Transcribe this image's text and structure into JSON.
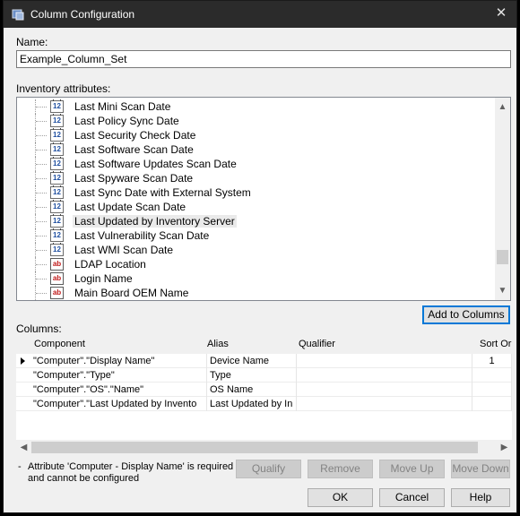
{
  "window": {
    "title": "Column Configuration",
    "close_glyph": "✕"
  },
  "name_label": "Name:",
  "name_value": "Example_Column_Set",
  "inventory_label": "Inventory attributes:",
  "tree_items": [
    {
      "label": "Last Mini Scan Date",
      "icon": "date-attribute-icon",
      "glyph": "12"
    },
    {
      "label": "Last Policy Sync Date",
      "icon": "date-attribute-icon",
      "glyph": "12"
    },
    {
      "label": "Last Security Check Date",
      "icon": "date-attribute-icon",
      "glyph": "12"
    },
    {
      "label": "Last Software Scan Date",
      "icon": "date-attribute-icon",
      "glyph": "12"
    },
    {
      "label": "Last Software Updates Scan Date",
      "icon": "date-attribute-icon",
      "glyph": "12"
    },
    {
      "label": "Last Spyware Scan Date",
      "icon": "date-attribute-icon",
      "glyph": "12"
    },
    {
      "label": "Last Sync Date with External System",
      "icon": "date-attribute-icon",
      "glyph": "12"
    },
    {
      "label": "Last Update Scan Date",
      "icon": "date-attribute-icon",
      "glyph": "12"
    },
    {
      "label": "Last Updated by Inventory Server",
      "icon": "date-attribute-icon",
      "glyph": "12"
    },
    {
      "label": "Last Vulnerability Scan Date",
      "icon": "date-attribute-icon",
      "glyph": "12"
    },
    {
      "label": "Last WMI Scan Date",
      "icon": "date-attribute-icon",
      "glyph": "12"
    },
    {
      "label": "LDAP Location",
      "icon": "text-attribute-icon",
      "glyph": "ab"
    },
    {
      "label": "Login Name",
      "icon": "text-attribute-icon",
      "glyph": "ab"
    },
    {
      "label": "Main Board OEM Name",
      "icon": "text-attribute-icon",
      "glyph": "ab"
    }
  ],
  "add_to_columns": "Add to Columns",
  "columns_label": "Columns:",
  "grid": {
    "headers": [
      "Component",
      "Alias",
      "Qualifier",
      "Sort Or"
    ],
    "rows": [
      {
        "component": "\"Computer\".\"Display Name\"",
        "alias": "Device Name",
        "qualifier": "",
        "sort": "1"
      },
      {
        "component": "\"Computer\".\"Type\"",
        "alias": "Type",
        "qualifier": "",
        "sort": ""
      },
      {
        "component": "\"Computer\".\"OS\".\"Name\"",
        "alias": "OS Name",
        "qualifier": "",
        "sort": ""
      },
      {
        "component": "\"Computer\".\"Last Updated by Invento",
        "alias": "Last Updated by In",
        "qualifier": "",
        "sort": ""
      }
    ]
  },
  "note": {
    "bullet": "-",
    "text": "Attribute 'Computer - Display Name' is required and cannot be configured"
  },
  "buttons": {
    "qualify": "Qualify",
    "remove": "Remove",
    "move_up": "Move Up",
    "move_down": "Move Down",
    "ok": "OK",
    "cancel": "Cancel",
    "help": "Help"
  },
  "colors": {
    "titlebar": "#2b2b2b",
    "focus": "#0078d7",
    "date_icon": "#1f4fa0",
    "text_icon": "#c01818"
  }
}
